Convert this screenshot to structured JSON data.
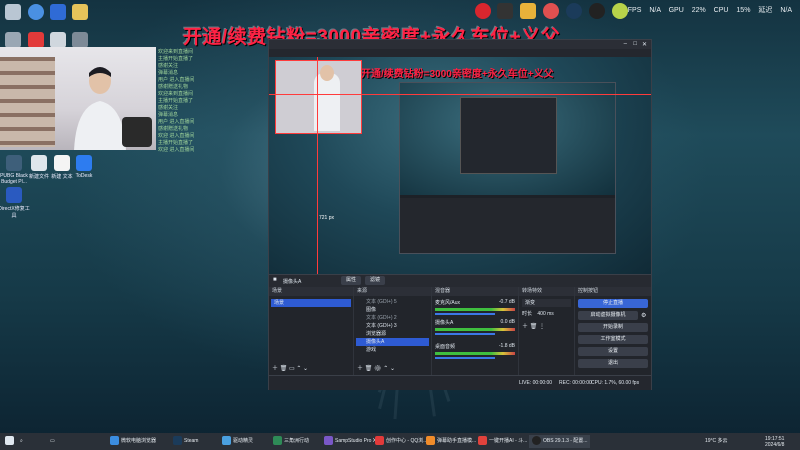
{
  "banner": "开通/续费钻粉=3000亲密度+永久车位+义父",
  "stats": {
    "fps_label": "FPS",
    "fps": "N/A",
    "gpu_label": "GPU",
    "gpu": "22%",
    "cpu_label": "CPU",
    "cpu": "15%",
    "latency_label": "延迟",
    "latency": "N/A"
  },
  "desktop_icons": [
    {
      "label": "PUBG Black Budget Pl..."
    },
    {
      "label": "新建文件"
    },
    {
      "label": "新建 文本"
    },
    {
      "label": "ToDesk"
    },
    {
      "label": "DirectX修复工具"
    }
  ],
  "obs": {
    "source_bar_label": "摄像头A",
    "props_label": "属性",
    "filters_label": "滤镜",
    "docks": {
      "scenes": "场景",
      "sources": "来源",
      "mixer": "混音器",
      "transitions": "转场特效",
      "controls": "控制按钮"
    },
    "scene_item": "场景",
    "source_items": [
      "文本 (GDI+) 5",
      "图像",
      "文本 (GDI+) 2",
      "文本 (GDI+) 3",
      "浏览器源",
      "摄像头A",
      "游戏"
    ],
    "mixer_tracks": [
      {
        "name": "麦克风/Aux",
        "db": "-0.7 dB"
      },
      {
        "name": "摄像头A",
        "db": "0.0 dB"
      },
      {
        "name": "桌面音频",
        "db": "-1.8 dB"
      }
    ],
    "transition": {
      "type": "渐变",
      "duration_label": "时长",
      "duration": "400 ms"
    },
    "controls": [
      "停止直播",
      "启动虚拟摄像机",
      "开始录制",
      "工作室模式",
      "设置",
      "退出"
    ],
    "status": {
      "live": "LIVE: 00:00:00",
      "rec": "REC: 00:00:00",
      "cpu": "CPU: 1.7%, 60.00 fps"
    },
    "preview_label": "721 px"
  },
  "chat_lines": [
    "欢迎来到直播间",
    "主播开始直播了",
    "感谢关注",
    "弹幕消息",
    "用户 进入直播间",
    "感谢赠送礼物",
    "欢迎来到直播间",
    "主播开始直播了",
    "感谢关注",
    "弹幕消息",
    "用户 进入直播间",
    "感谢赠送礼物",
    "欢迎 进入直播间",
    "主播开始直播了",
    "欢迎 进入直播间"
  ],
  "taskbar": {
    "items": [
      "微软电脑浏览器",
      "Steam",
      "驱动精灵",
      "三角洲行动",
      "SampStudio Pro X...",
      "创作中心 - QQ浏...",
      "弹幕助手直播模...",
      "一键开播AI - 斗...",
      "OBS 29.1.3 - 配置..."
    ],
    "temp": "19°C 多云",
    "time": "19:17:51",
    "date": "2024/6/8"
  },
  "colors": {
    "accent": "#3866d6",
    "banner": "#ff2244",
    "active_scene": "#2e5bd3"
  }
}
